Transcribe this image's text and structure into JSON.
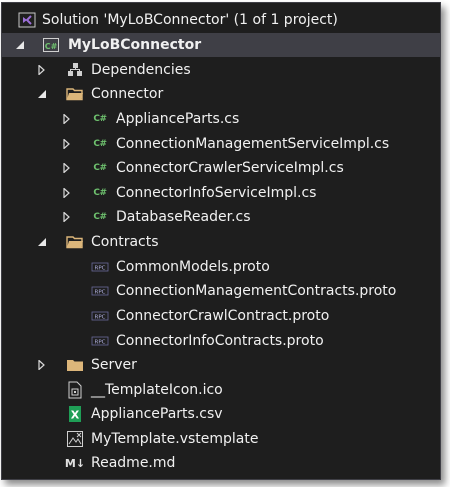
{
  "solution": {
    "label": "Solution 'MyLoBConnector' (1 of 1 project)"
  },
  "project": {
    "label": "MyLoBConnector",
    "icon_text": "C#"
  },
  "items": {
    "dependencies": "Dependencies",
    "connector_folder": "Connector",
    "appliance_parts_cs": "ApplianceParts.cs",
    "conn_mgmt_impl_cs": "ConnectionManagementServiceImpl.cs",
    "crawler_impl_cs": "ConnectorCrawlerServiceImpl.cs",
    "info_impl_cs": "ConnectorInfoServiceImpl.cs",
    "database_reader_cs": "DatabaseReader.cs",
    "contracts_folder": "Contracts",
    "common_models_proto": "CommonModels.proto",
    "conn_mgmt_contracts_proto": "ConnectionManagementContracts.proto",
    "crawl_contract_proto": "ConnectorCrawlContract.proto",
    "info_contracts_proto": "ConnectorInfoContracts.proto",
    "server_folder": "Server",
    "template_icon": "__TemplateIcon.ico",
    "appliance_parts_csv": "ApplianceParts.csv",
    "vstemplate": "MyTemplate.vstemplate",
    "readme": "Readme.md"
  },
  "icons": {
    "cs_text": "C#",
    "rpc_text": "RPC",
    "csv_text": "X",
    "md_text": "M↓"
  },
  "colors": {
    "background": "#1e1e1e",
    "selected_row": "#3f3f46",
    "text": "#f1f1f1",
    "folder": "#dcb67a",
    "csharp": "#6ec16e",
    "excel": "#1f9e56",
    "vs_purple": "#9b6ed6"
  }
}
